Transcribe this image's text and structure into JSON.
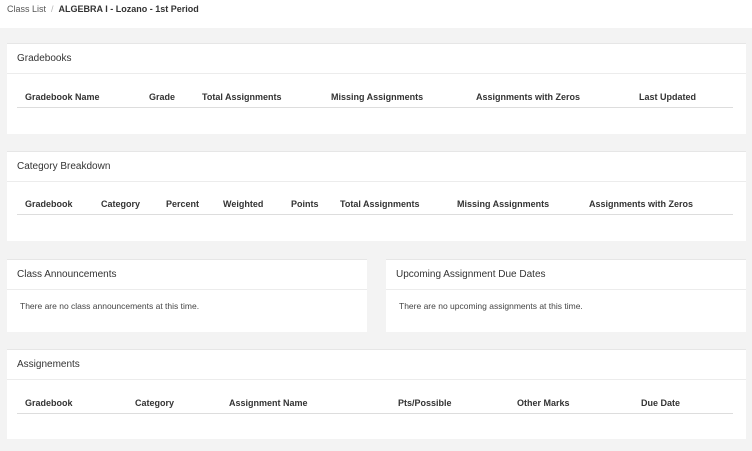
{
  "breadcrumb": {
    "parent": "Class List",
    "separator": "/",
    "current": "ALGEBRA I - Lozano - 1st Period"
  },
  "gradebooks": {
    "title": "Gradebooks",
    "columns": [
      "Gradebook Name",
      "Grade",
      "Total Assignments",
      "Missing Assignments",
      "Assignments with Zeros",
      "Last Updated"
    ]
  },
  "category_breakdown": {
    "title": "Category Breakdown",
    "columns": [
      "Gradebook",
      "Category",
      "Percent",
      "Weighted",
      "Points",
      "Total Assignments",
      "Missing Assignments",
      "Assignments with Zeros"
    ]
  },
  "announcements": {
    "title": "Class Announcements",
    "empty_message": "There are no class announcements at this time."
  },
  "upcoming": {
    "title": "Upcoming Assignment Due Dates",
    "empty_message": "There are no upcoming assignments at this time."
  },
  "assignments": {
    "title": "Assignements",
    "columns": [
      "Gradebook",
      "Category",
      "Assignment Name",
      "Pts/Possible",
      "Other Marks",
      "Due Date"
    ]
  }
}
